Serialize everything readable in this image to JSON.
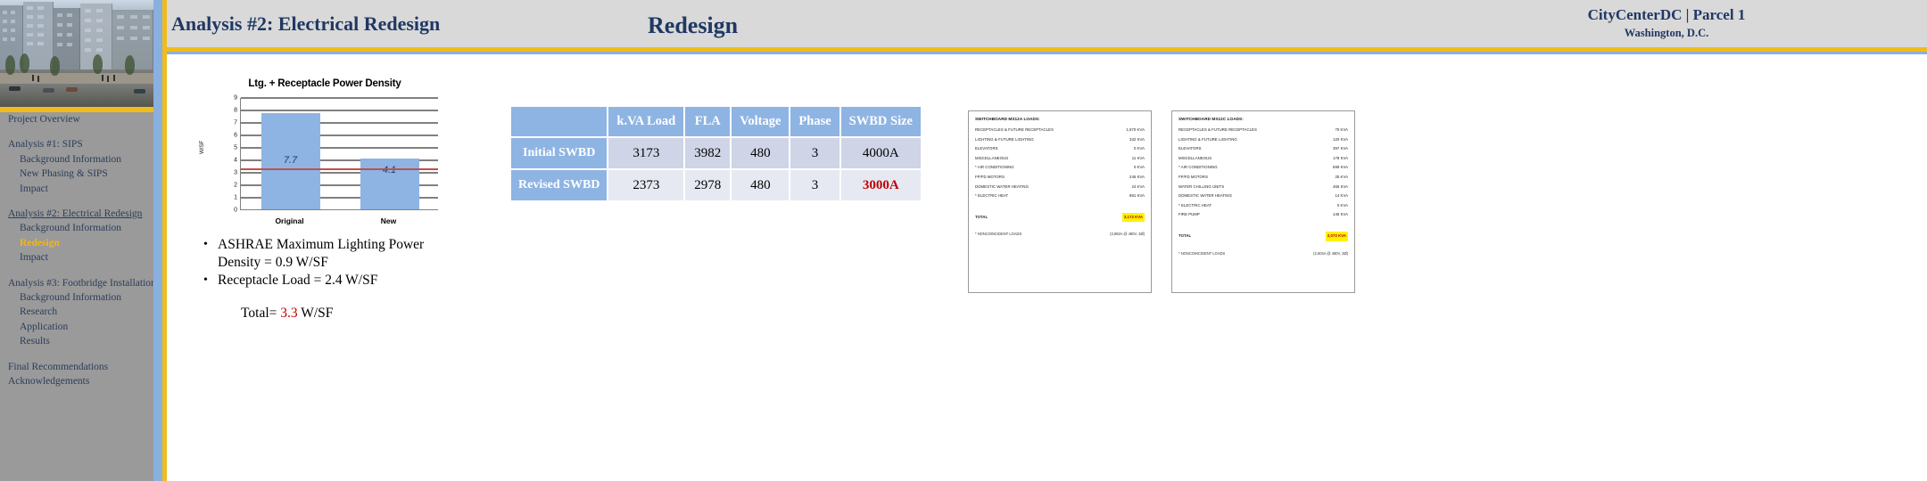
{
  "header": {
    "analysis_title": "Analysis #2: Electrical Redesign",
    "section_title": "Redesign",
    "project_title": "CityCenterDC | Parcel 1",
    "project_subtitle": "Washington, D.C."
  },
  "sidebar": {
    "items": [
      {
        "label": "Project Overview",
        "level": "top",
        "state": "normal"
      },
      {
        "label": "Analysis #1: SIPS",
        "level": "top",
        "state": "normal"
      },
      {
        "label": "Background Information",
        "level": "sub",
        "state": "normal"
      },
      {
        "label": "New Phasing & SIPS",
        "level": "sub",
        "state": "normal"
      },
      {
        "label": "Impact",
        "level": "sub",
        "state": "normal"
      },
      {
        "label": "Analysis #2: Electrical  Redesign",
        "level": "top",
        "state": "underline"
      },
      {
        "label": "Background Information",
        "level": "sub",
        "state": "normal"
      },
      {
        "label": "Redesign",
        "level": "sub",
        "state": "current"
      },
      {
        "label": "Impact",
        "level": "sub",
        "state": "normal"
      },
      {
        "label": "Analysis #3: Footbridge Installation",
        "level": "top",
        "state": "normal"
      },
      {
        "label": "Background Information",
        "level": "sub",
        "state": "normal"
      },
      {
        "label": "Research",
        "level": "sub",
        "state": "normal"
      },
      {
        "label": "Application",
        "level": "sub",
        "state": "normal"
      },
      {
        "label": "Results",
        "level": "sub",
        "state": "normal"
      },
      {
        "label": "Final Recommendations",
        "level": "top",
        "state": "normal"
      },
      {
        "label": "Acknowledgements",
        "level": "top",
        "state": "normal"
      }
    ]
  },
  "chart_data": {
    "type": "bar",
    "title": "Ltg. + Receptacle Power Density",
    "categories": [
      "Original",
      "New"
    ],
    "values": [
      7.7,
      4.1
    ],
    "data_labels": [
      "7.7",
      "4.1"
    ],
    "xlabel": "",
    "ylabel": "W/SF",
    "ylim": [
      0,
      9
    ],
    "yticks": [
      0,
      1,
      2,
      3,
      4,
      5,
      6,
      7,
      8,
      9
    ],
    "grid": true,
    "legend": "none",
    "series_color": "#8eb4e3",
    "threshold": {
      "value": 3.3,
      "color": "#c0504d",
      "label": ""
    }
  },
  "bullets": {
    "items": [
      "ASHRAE Maximum Lighting Power Density = 0.9 W/SF",
      "Receptacle Load = 2.4 W/SF"
    ],
    "total_prefix": "Total=",
    "total_value": "3.3",
    "total_suffix": "W/SF"
  },
  "table": {
    "corner_label": "",
    "columns": [
      "k.VA Load",
      "FLA",
      "Voltage",
      "Phase",
      "SWBD Size"
    ],
    "rows": [
      {
        "name": "Initial SWBD",
        "cells": [
          "3173",
          "3982",
          "480",
          "3",
          "4000A"
        ],
        "emphasis": [
          false,
          false,
          false,
          false,
          false
        ]
      },
      {
        "name": "Revised SWBD",
        "cells": [
          "2373",
          "2978",
          "480",
          "3",
          "3000A"
        ],
        "emphasis": [
          false,
          false,
          false,
          false,
          true
        ]
      }
    ]
  },
  "panels": [
    {
      "title": "SWITCHBOARD MS12A LOADS:",
      "rows": [
        {
          "label": "RECEPTACLES & FUTURE RECEPTACLES",
          "amount": "1,670 KVA"
        },
        {
          "label": "LIGHTING & FUTURE LIGHTING",
          "amount": "332 KVA"
        },
        {
          "label": "ELEVATORS",
          "amount": "0 KVA"
        },
        {
          "label": "MISCELLANEOUS",
          "amount": "11 KVA"
        },
        {
          "label": "* AIR CONDITIONING",
          "amount": "0 KVA"
        },
        {
          "label": "FP/FD MOTORS",
          "amount": "245 KVA"
        },
        {
          "label": "DOMESTIC WATER HEATING",
          "amount": "24 KVA"
        },
        {
          "label": "* ELECTRIC HEAT",
          "amount": "891 KVA"
        }
      ],
      "total_label": "TOTAL",
      "total_amount": "3,173 KVA",
      "footnote": "* NONCOINCIDENT LOADS",
      "foot_amount": "(3,982A @ 480V, 3Ø)"
    },
    {
      "title": "SWITCHBOARD MS12C LOADS:",
      "rows": [
        {
          "label": "RECEPTACLES & FUTURE RECEPTACLES",
          "amount": "70 KVA"
        },
        {
          "label": "LIGHTING & FUTURE LIGHTING",
          "amount": "120 KVA"
        },
        {
          "label": "ELEVATORS",
          "amount": "397 KVA"
        },
        {
          "label": "MISCELLANEOUS",
          "amount": "178 KVA"
        },
        {
          "label": "* AIR CONDITIONING",
          "amount": "699 KVA"
        },
        {
          "label": "FP/FD MOTORS",
          "amount": "25 KVA"
        },
        {
          "label": "WATER CHILLING UNITS",
          "amount": "465 KVA"
        },
        {
          "label": "DOMESTIC WATER HEATING",
          "amount": "14 KVA"
        },
        {
          "label": "* ELECTRIC HEAT",
          "amount": "0 KVA"
        },
        {
          "label": "FIRE PUMP",
          "amount": "146 KVA"
        }
      ],
      "total_label": "TOTAL",
      "total_amount": "2,073 KVA",
      "footnote": "* NONCOINCIDENT LOADS",
      "foot_amount": "(2,604A @ 480V, 3Ø)"
    }
  ],
  "colors": {
    "accent_yellow": "#f0bc1c",
    "accent_blue": "#8ab0e0",
    "navy": "#1f3864",
    "red": "#c00000",
    "sidebar_gray": "#9a9a9a",
    "header_gray": "#d9d9d9"
  }
}
